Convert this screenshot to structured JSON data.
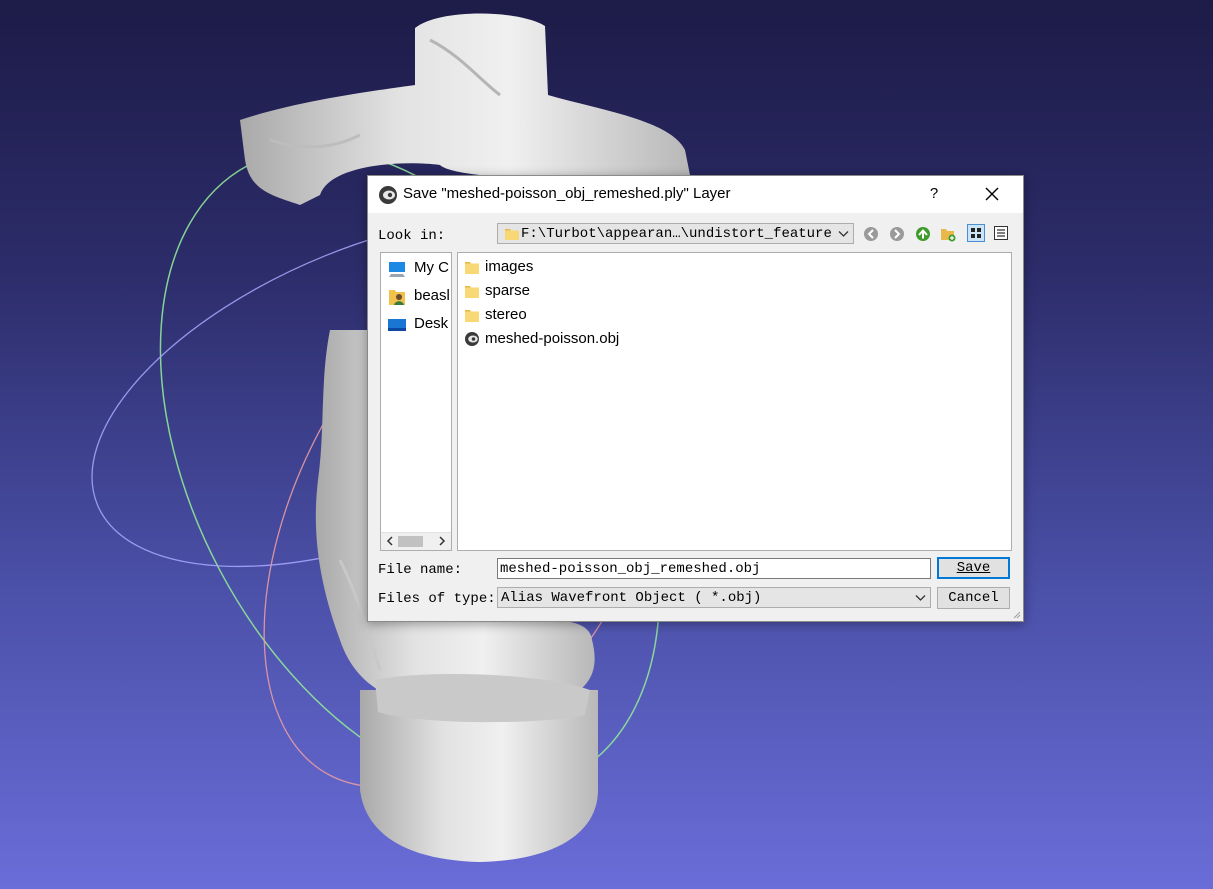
{
  "dialog": {
    "title": "Save \"meshed-poisson_obj_remeshed.ply\" Layer",
    "help": "?",
    "look_in_label": "Look in:",
    "path": "F:\\Turbot\\appearan…\\undistort_feature",
    "sidebar_items": [
      {
        "label": "My C",
        "icon": "computer-icon"
      },
      {
        "label": "beasl",
        "icon": "user-folder-icon"
      },
      {
        "label": "Desk",
        "icon": "desktop-icon"
      }
    ],
    "files": [
      {
        "label": "images",
        "icon": "folder-icon"
      },
      {
        "label": "sparse",
        "icon": "folder-icon"
      },
      {
        "label": "stereo",
        "icon": "folder-icon"
      },
      {
        "label": "meshed-poisson.obj",
        "icon": "meshlab-file-icon"
      }
    ],
    "file_name_label": "File name:",
    "file_name_value": "meshed-poisson_obj_remeshed.obj",
    "file_type_label": "Files of type:",
    "file_type_value": "Alias Wavefront Object ( *.obj)",
    "save_label": "Save",
    "cancel_label": "Cancel"
  },
  "colors": {
    "background_top": "#1d1b47",
    "background_bottom": "#6a6dd8",
    "accent": "#0078d7",
    "folder": "#f8d775"
  }
}
